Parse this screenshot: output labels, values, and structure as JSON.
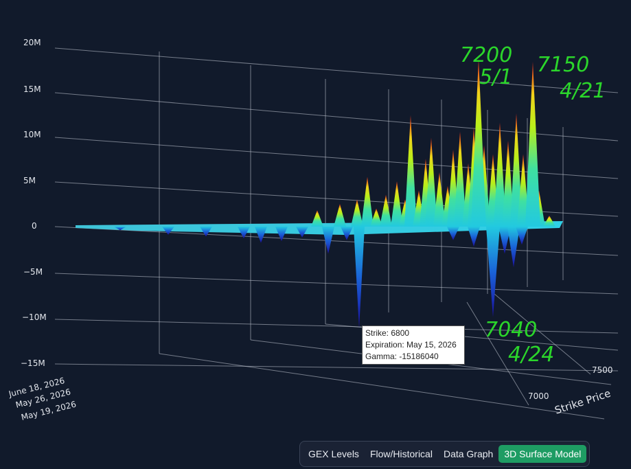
{
  "chart_data": {
    "type": "surface3d",
    "z_ticks": [
      "20M",
      "15M",
      "10M",
      "5M",
      "0",
      "−5M",
      "−10M",
      "−15M"
    ],
    "z_values": [
      20000000,
      15000000,
      10000000,
      5000000,
      0,
      -5000000,
      -10000000,
      -15000000
    ],
    "zlim": [
      -15000000,
      20000000
    ],
    "x_title": "Strike Price",
    "x_ticks": [
      "7000",
      "7500"
    ],
    "x_values": [
      7000,
      7500
    ],
    "y_ticks": [
      "June 18, 2026",
      "May 26, 2026",
      "May 19, 2026"
    ],
    "colorscale": "jet",
    "highlight_peaks": [
      {
        "strike": 7200,
        "gamma": 18500000
      },
      {
        "strike": 7150,
        "gamma": 18200000
      },
      {
        "strike": 6800,
        "gamma": -15186040
      },
      {
        "strike": 7040,
        "gamma": -10500000
      }
    ]
  },
  "tooltip": {
    "strike": "Strike: 6800",
    "expiration": "Expiration: May 15, 2026",
    "gamma": "Gamma: -15186040"
  },
  "annotations": [
    {
      "line1": "7200",
      "line2": "5/1"
    },
    {
      "line1": "7150",
      "line2": "4/21"
    },
    {
      "line1": "7040",
      "line2": "4/24"
    }
  ],
  "annotation_color": "#2bd62b",
  "tabs": [
    {
      "label": "GEX Levels",
      "active": false
    },
    {
      "label": "Flow/Historical",
      "active": false
    },
    {
      "label": "Data Graph",
      "active": false
    },
    {
      "label": "3D Surface Model",
      "active": true
    }
  ],
  "colors": {
    "background": "#111a2b",
    "active_tab": "#1e9c63"
  }
}
